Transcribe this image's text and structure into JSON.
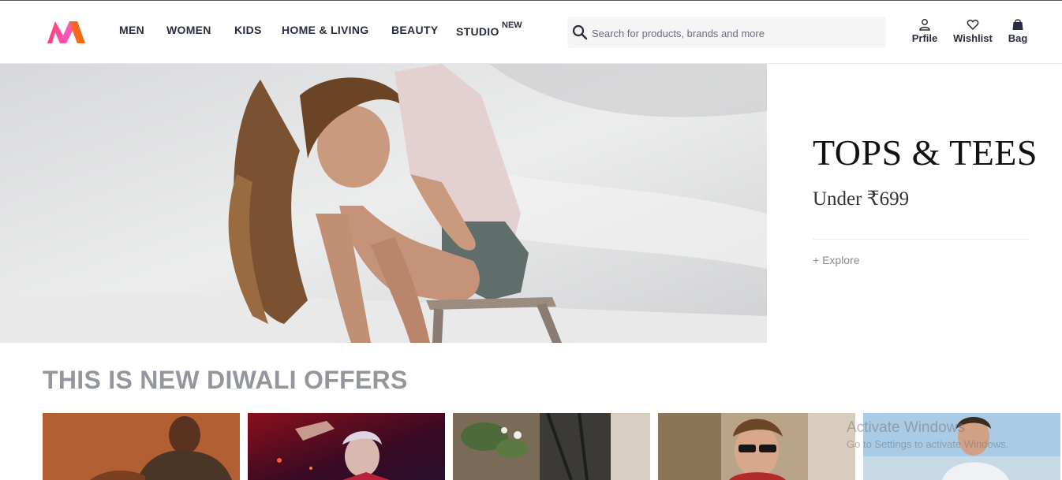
{
  "header": {
    "logo": "myntra-logo",
    "nav": [
      {
        "label": "MEN"
      },
      {
        "label": "WOMEN"
      },
      {
        "label": "KIDS"
      },
      {
        "label": "HOME & LIVING"
      },
      {
        "label": "BEAUTY"
      },
      {
        "label": "STUDIO",
        "badge": "NEW"
      }
    ],
    "search": {
      "placeholder": "Search for products, brands and more",
      "value": "",
      "icon": "search-icon"
    },
    "actions": [
      {
        "label": "Prfile",
        "icon": "profile-icon"
      },
      {
        "label": "Wishlist",
        "icon": "heart-icon"
      },
      {
        "label": "Bag",
        "icon": "bag-icon"
      }
    ]
  },
  "hero": {
    "image": "woman-sitting-on-stool-photo",
    "title": "TOPS & TEES",
    "subtitle": "Under ₹699",
    "cta": "+ Explore"
  },
  "offers": {
    "title": "THIS IS NEW DIWALI OFFERS",
    "cards": [
      {
        "image": "man-portrait-brown-background"
      },
      {
        "image": "man-red-stage-lights"
      },
      {
        "image": "plant-window-scene"
      },
      {
        "image": "man-sunglasses-street"
      },
      {
        "image": "man-blue-sky-shirt"
      }
    ]
  },
  "os_watermark": {
    "title": "Activate Windows",
    "subtitle": "Go to Settings to activate Windows."
  },
  "colors": {
    "text": "#282c3f",
    "brand_pink": "#ff3f6c",
    "brand_orange": "#f26a10",
    "section_title": "#94969f",
    "search_bg": "#f5f5f6"
  }
}
